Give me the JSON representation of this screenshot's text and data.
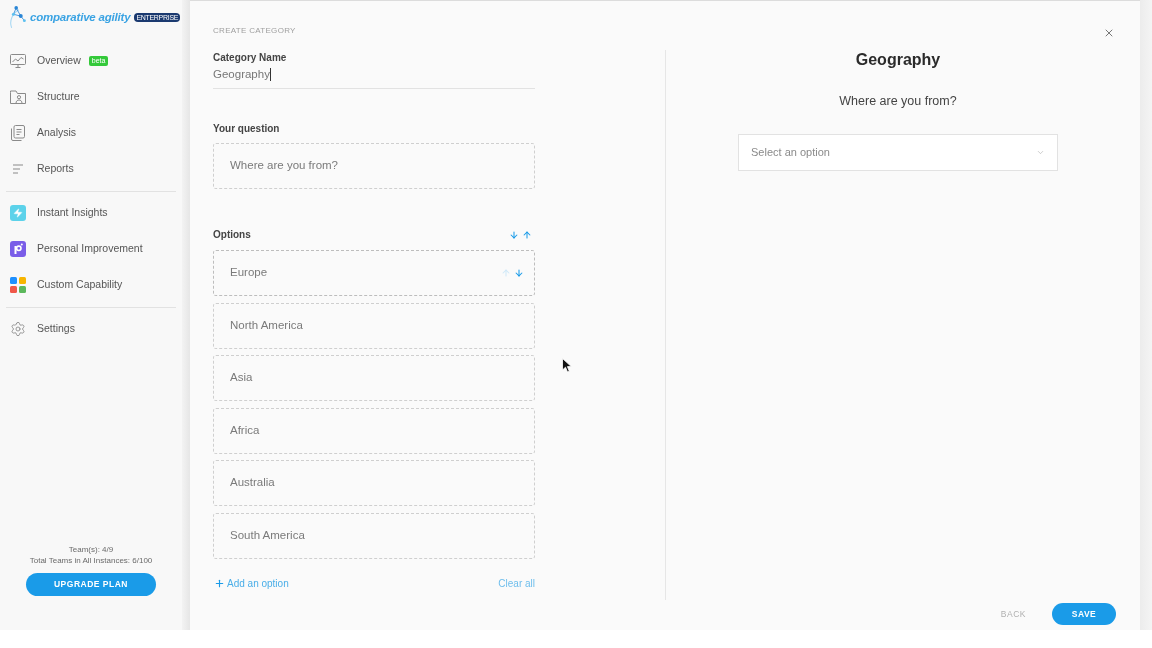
{
  "sidebar": {
    "logo": {
      "wordmark": "comparative agility",
      "badge": "ENTERPRISE"
    },
    "sections": [
      {
        "items": [
          {
            "label": "Overview",
            "badge": "beta"
          },
          {
            "label": "Structure"
          },
          {
            "label": "Analysis"
          },
          {
            "label": "Reports"
          }
        ]
      },
      {
        "items": [
          {
            "label": "Instant Insights"
          },
          {
            "label": "Personal Improvement"
          },
          {
            "label": "Custom Capability"
          }
        ]
      },
      {
        "items": [
          {
            "label": "Settings"
          }
        ]
      }
    ],
    "usage": [
      "Team(s): 4/9",
      "Total Teams in All Instances: 6/100"
    ],
    "upgrade_button": "UPGRADE PLAN"
  },
  "form": {
    "heading": "CREATE CATEGORY",
    "category_name": {
      "label": "Category Name",
      "value": "Geography",
      "focused": true
    },
    "question": {
      "label": "Your question",
      "value": "Where are you from?"
    },
    "options": {
      "label": "Options",
      "items": [
        {
          "text": "Europe",
          "hovered": true
        },
        {
          "text": "North America",
          "hovered": false
        },
        {
          "text": "Asia",
          "hovered": false
        },
        {
          "text": "Africa",
          "hovered": false
        },
        {
          "text": "Australia",
          "hovered": false
        },
        {
          "text": "South America",
          "hovered": false
        }
      ],
      "add_link": "Add an option",
      "clear_link": "Clear all"
    }
  },
  "preview": {
    "title": "Geography",
    "question": "Where are you from?",
    "select": {
      "placeholder": "Select an option"
    }
  },
  "footer": {
    "back_button": "BACK",
    "save_button": "SAVE"
  }
}
